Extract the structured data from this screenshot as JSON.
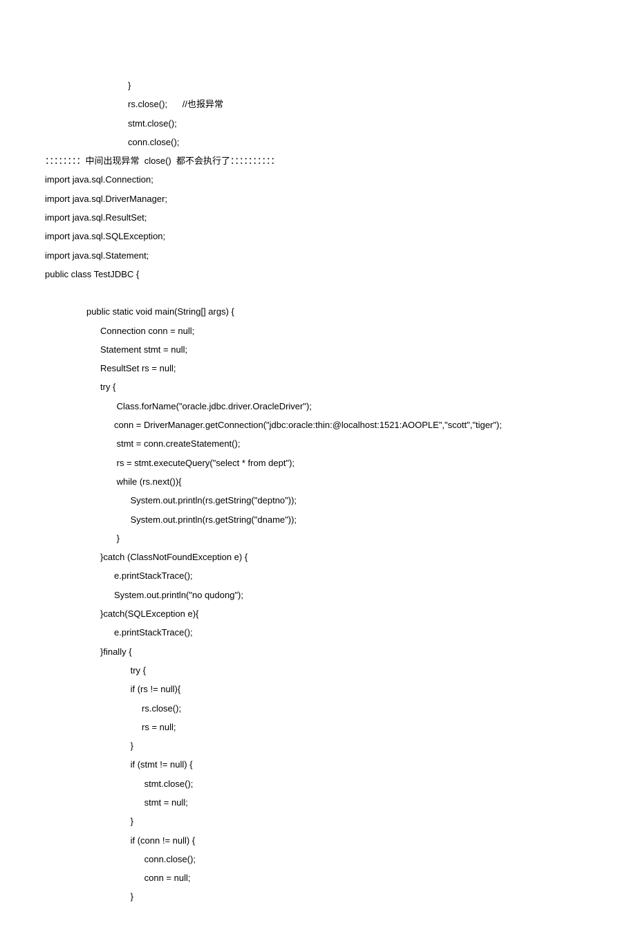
{
  "lines": [
    {
      "indent": 5,
      "text": "}"
    },
    {
      "indent": 5,
      "text": "rs.close();      //也报异常"
    },
    {
      "indent": 5,
      "text": "stmt.close();"
    },
    {
      "indent": 5,
      "text": "conn.close();"
    },
    {
      "indent": 0,
      "text": "：：：：：：：：中间出现异常  close()  都不会执行了：：：：：：：：：："
    },
    {
      "indent": 0,
      "text": "import java.sql.Connection;"
    },
    {
      "indent": 0,
      "text": "import java.sql.DriverManager;"
    },
    {
      "indent": 0,
      "text": "import java.sql.ResultSet;"
    },
    {
      "indent": 0,
      "text": "import java.sql.SQLException;"
    },
    {
      "indent": 0,
      "text": "import java.sql.Statement;"
    },
    {
      "indent": 0,
      "text": "public class TestJDBC {"
    },
    {
      "indent": 0,
      "text": "",
      "blank": true
    },
    {
      "indent": 2,
      "text": "public static void main(String[] args) {"
    },
    {
      "indent": 3,
      "text": "Connection conn = null;"
    },
    {
      "indent": 3,
      "text": "Statement stmt = null;"
    },
    {
      "indent": 3,
      "text": "ResultSet rs = null;"
    },
    {
      "indent": 3,
      "text": "try {"
    },
    {
      "indent": 4,
      "text": " Class.forName(\"oracle.jdbc.driver.OracleDriver\");"
    },
    {
      "indent": 4,
      "text": "conn = DriverManager.getConnection(\"jdbc:oracle:thin:@localhost:1521:AOOPLE\",\"scott\",\"tiger\");"
    },
    {
      "indent": 4,
      "text": " stmt = conn.createStatement();"
    },
    {
      "indent": 4,
      "text": " rs = stmt.executeQuery(\"select * from dept\");"
    },
    {
      "indent": 4,
      "text": " while (rs.next()){"
    },
    {
      "indent": 5,
      "text": " System.out.println(rs.getString(\"deptno\"));"
    },
    {
      "indent": 5,
      "text": " System.out.println(rs.getString(\"dname\"));"
    },
    {
      "indent": 4,
      "text": " }"
    },
    {
      "indent": 3,
      "text": "}catch (ClassNotFoundException e) {"
    },
    {
      "indent": 4,
      "text": "e.printStackTrace();"
    },
    {
      "indent": 4,
      "text": "System.out.println(\"no qudong\");"
    },
    {
      "indent": 3,
      "text": "}catch(SQLException e){"
    },
    {
      "indent": 4,
      "text": "e.printStackTrace();"
    },
    {
      "indent": 3,
      "text": "}finally {"
    },
    {
      "indent": 5,
      "text": " try {"
    },
    {
      "indent": 5,
      "text": " if (rs != null){"
    },
    {
      "indent": 6,
      "text": "rs.close();"
    },
    {
      "indent": 6,
      "text": "rs = null;"
    },
    {
      "indent": 5,
      "text": " }"
    },
    {
      "indent": 5,
      "text": " if (stmt != null) {"
    },
    {
      "indent": 6,
      "text": " stmt.close();"
    },
    {
      "indent": 6,
      "text": " stmt = null;"
    },
    {
      "indent": 5,
      "text": " }"
    },
    {
      "indent": 5,
      "text": " if (conn != null) {"
    },
    {
      "indent": 6,
      "text": " conn.close();"
    },
    {
      "indent": 6,
      "text": " conn = null;"
    },
    {
      "indent": 5,
      "text": " }"
    }
  ]
}
